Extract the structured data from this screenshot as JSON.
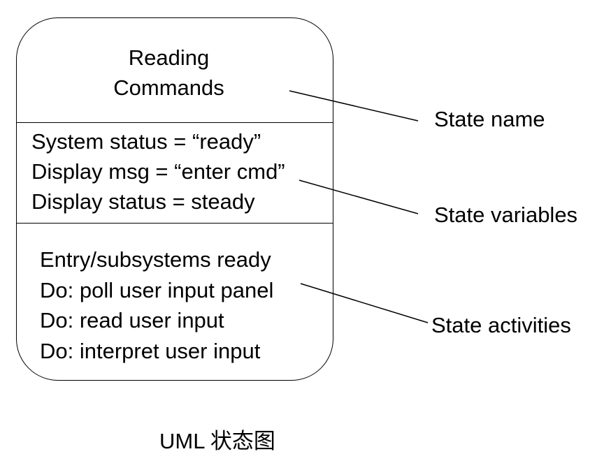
{
  "state": {
    "name_lines": [
      "Reading",
      "Commands"
    ],
    "variables": [
      "System status = “ready”",
      "Display msg = “enter cmd”",
      "Display status = steady"
    ],
    "activities": [
      "Entry/subsystems ready",
      "Do: poll user input panel",
      "Do: read user input",
      "Do: interpret user input"
    ]
  },
  "annotations": {
    "state_name": "State name",
    "state_variables": "State variables",
    "state_activities": "State activities"
  },
  "caption": {
    "latin": "UML ",
    "cjk": "状态图"
  }
}
